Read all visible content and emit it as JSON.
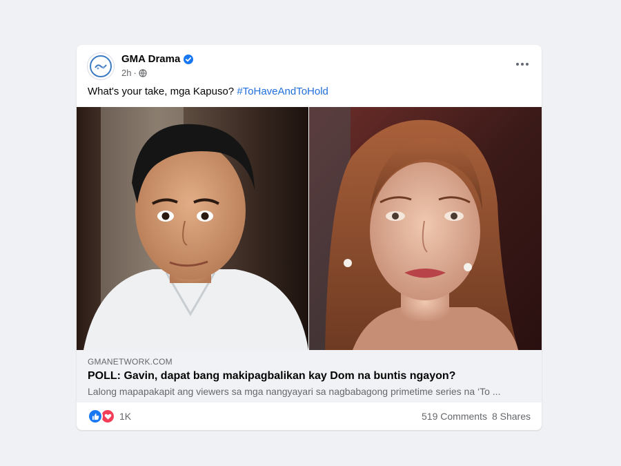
{
  "post": {
    "page_name": "GMA Drama",
    "verified_icon": "verified-badge-icon",
    "time": "2h",
    "separator": "·",
    "audience_icon": "globe-icon",
    "text": "What's your take, mga Kapuso? ",
    "hashtag": "#ToHaveAndToHold",
    "more_icon": "more-options-icon"
  },
  "link_preview": {
    "domain": "GMANETWORK.COM",
    "title": "POLL: Gavin, dapat bang makipagbalikan kay Dom na buntis ngayon?",
    "description": "Lalong mapapakapit ang viewers sa mga nangyayari sa nagbabagong primetime series na ‘To ..."
  },
  "reactions": {
    "icons": [
      "like-icon",
      "love-icon"
    ],
    "count": "1K",
    "comments": "519 Comments",
    "shares": "8 Shares"
  },
  "colors": {
    "background": "#f0f1f4",
    "card": "#ffffff",
    "hashtag": "#216fdb",
    "verified": "#1877f2",
    "like": "#1877f2",
    "love": "#f33e58",
    "link_bg": "#f0f2f5"
  }
}
